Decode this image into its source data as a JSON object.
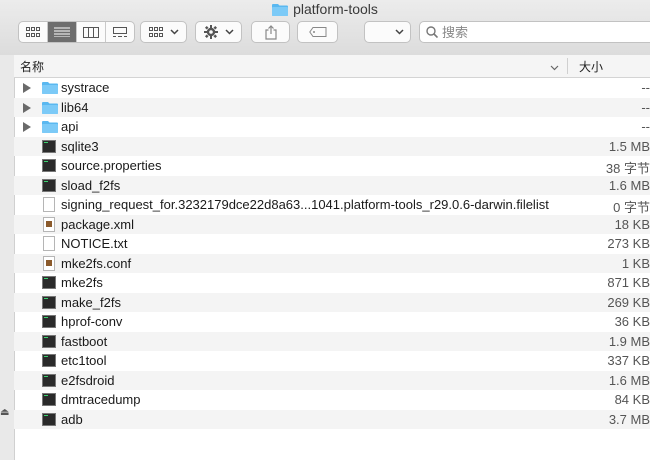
{
  "window": {
    "title": "platform-tools"
  },
  "toolbar": {
    "search_placeholder": "搜索",
    "view_modes": [
      "icon-view",
      "list-view",
      "column-view",
      "gallery-view"
    ],
    "active_view": "list-view"
  },
  "columns": {
    "name": "名称",
    "size": "大小"
  },
  "files": [
    {
      "name": "systrace",
      "size": "--",
      "type": "folder"
    },
    {
      "name": "lib64",
      "size": "--",
      "type": "folder"
    },
    {
      "name": "api",
      "size": "--",
      "type": "folder"
    },
    {
      "name": "sqlite3",
      "size": "1.5 MB",
      "type": "exec"
    },
    {
      "name": "source.properties",
      "size": "38 字节",
      "type": "exec"
    },
    {
      "name": "sload_f2fs",
      "size": "1.6 MB",
      "type": "exec"
    },
    {
      "name": "signing_request_for.3232179dce22d8a63...1041.platform-tools_r29.0.6-darwin.filelist",
      "size": "0 字节",
      "type": "doc"
    },
    {
      "name": "package.xml",
      "size": "18 KB",
      "type": "xml"
    },
    {
      "name": "NOTICE.txt",
      "size": "273 KB",
      "type": "doc"
    },
    {
      "name": "mke2fs.conf",
      "size": "1 KB",
      "type": "xml"
    },
    {
      "name": "mke2fs",
      "size": "871 KB",
      "type": "exec"
    },
    {
      "name": "make_f2fs",
      "size": "269 KB",
      "type": "exec"
    },
    {
      "name": "hprof-conv",
      "size": "36 KB",
      "type": "exec"
    },
    {
      "name": "fastboot",
      "size": "1.9 MB",
      "type": "exec"
    },
    {
      "name": "etc1tool",
      "size": "337 KB",
      "type": "exec"
    },
    {
      "name": "e2fsdroid",
      "size": "1.6 MB",
      "type": "exec"
    },
    {
      "name": "dmtracedump",
      "size": "84 KB",
      "type": "exec"
    },
    {
      "name": "adb",
      "size": "3.7 MB",
      "type": "exec"
    }
  ],
  "colors": {
    "folder": "#5ab8f0",
    "selected_view": "#6e6e6e"
  }
}
